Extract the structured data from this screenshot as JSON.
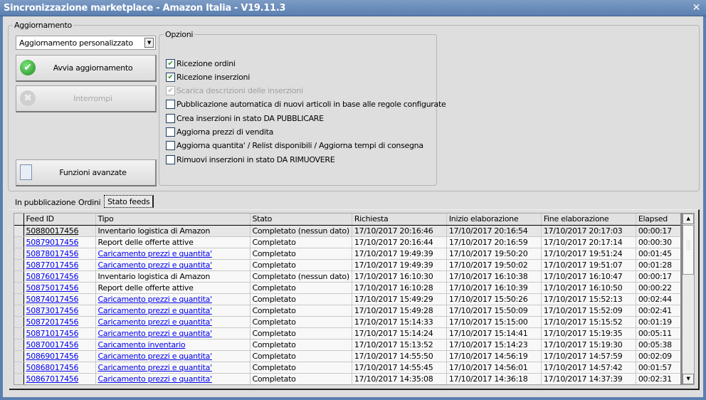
{
  "window": {
    "title": "Sincronizzazione marketplace - Amazon Italia - V19.11.3",
    "close": "✕"
  },
  "update": {
    "group_label": "Aggiornamento",
    "mode": "Aggiornamento personalizzato",
    "start": "Avvia aggiornamento",
    "stop": "Interrompi",
    "advanced": "Funzioni avanzate"
  },
  "options": {
    "group_label": "Opzioni",
    "items": [
      {
        "label": "Ricezione ordini",
        "checked": true,
        "disabled": false
      },
      {
        "label": "Ricezione inserzioni",
        "checked": true,
        "disabled": false
      },
      {
        "label": "Scarica descrizioni delle inserzioni",
        "checked": true,
        "disabled": true
      },
      {
        "label": "Pubblicazione automatica di nuovi articoli in base alle regole configurate",
        "checked": false,
        "disabled": false
      },
      {
        "label": "Crea inserzioni in stato DA PUBBLICARE",
        "checked": false,
        "disabled": false
      },
      {
        "label": "Aggiorna prezzi di vendita",
        "checked": false,
        "disabled": false
      },
      {
        "label": "Aggiorna quantita' / Relist disponibili / Aggiorna tempi di consegna",
        "checked": false,
        "disabled": false
      },
      {
        "label": "Rimuovi inserzioni in stato DA RIMUOVERE",
        "checked": false,
        "disabled": false
      }
    ]
  },
  "tabs": [
    "In pubblicazione",
    "Ordini",
    "Stato feeds"
  ],
  "active_tab": "Stato feeds",
  "table": {
    "columns": [
      "Feed ID",
      "Tipo",
      "Stato",
      "Richiesta",
      "Inizio elaborazione",
      "Fine elaborazione",
      "Elapsed"
    ],
    "rows": [
      [
        "50880017456",
        "Inventario logistica di Amazon",
        "Completato (nessun dato)",
        "17/10/2017 20:16:46",
        "17/10/2017 20:16:54",
        "17/10/2017 20:17:03",
        "00:00:17"
      ],
      [
        "50879017456",
        "Report delle offerte attive",
        "Completato",
        "17/10/2017 20:16:44",
        "17/10/2017 20:16:59",
        "17/10/2017 20:17:14",
        "00:00:30"
      ],
      [
        "50878017456",
        "Caricamento prezzi e quantita'",
        "Completato",
        "17/10/2017 19:49:39",
        "17/10/2017 19:50:20",
        "17/10/2017 19:51:24",
        "00:01:45"
      ],
      [
        "50877017456",
        "Caricamento prezzi e quantita'",
        "Completato",
        "17/10/2017 19:49:39",
        "17/10/2017 19:50:02",
        "17/10/2017 19:51:07",
        "00:01:28"
      ],
      [
        "50876017456",
        "Inventario logistica di Amazon",
        "Completato (nessun dato)",
        "17/10/2017 16:10:30",
        "17/10/2017 16:10:38",
        "17/10/2017 16:10:47",
        "00:00:17"
      ],
      [
        "50875017456",
        "Report delle offerte attive",
        "Completato",
        "17/10/2017 16:10:28",
        "17/10/2017 16:10:39",
        "17/10/2017 16:10:50",
        "00:00:22"
      ],
      [
        "50874017456",
        "Caricamento prezzi e quantita'",
        "Completato",
        "17/10/2017 15:49:29",
        "17/10/2017 15:50:26",
        "17/10/2017 15:52:13",
        "00:02:44"
      ],
      [
        "50873017456",
        "Caricamento prezzi e quantita'",
        "Completato",
        "17/10/2017 15:49:28",
        "17/10/2017 15:50:09",
        "17/10/2017 15:52:09",
        "00:02:41"
      ],
      [
        "50872017456",
        "Caricamento prezzi e quantita'",
        "Completato",
        "17/10/2017 15:14:33",
        "17/10/2017 15:15:00",
        "17/10/2017 15:15:52",
        "00:01:19"
      ],
      [
        "50871017456",
        "Caricamento prezzi e quantita'",
        "Completato",
        "17/10/2017 15:14:24",
        "17/10/2017 15:14:41",
        "17/10/2017 15:19:35",
        "00:05:11"
      ],
      [
        "50870017456",
        "Caricamento inventario",
        "Completato",
        "17/10/2017 15:13:52",
        "17/10/2017 15:14:23",
        "17/10/2017 15:19:30",
        "00:05:38"
      ],
      [
        "50869017456",
        "Caricamento prezzi e quantita'",
        "Completato",
        "17/10/2017 14:55:50",
        "17/10/2017 14:56:19",
        "17/10/2017 14:57:59",
        "00:02:09"
      ],
      [
        "50868017456",
        "Caricamento prezzi e quantita'",
        "Completato",
        "17/10/2017 14:55:45",
        "17/10/2017 14:56:01",
        "17/10/2017 14:57:42",
        "00:01:57"
      ],
      [
        "50867017456",
        "Caricamento prezzi e quantita'",
        "Completato",
        "17/10/2017 14:35:08",
        "17/10/2017 14:36:18",
        "17/10/2017 14:37:39",
        "00:02:31"
      ]
    ],
    "linked_types": [
      "Caricamento prezzi e quantita'",
      "Caricamento inventario"
    ]
  }
}
